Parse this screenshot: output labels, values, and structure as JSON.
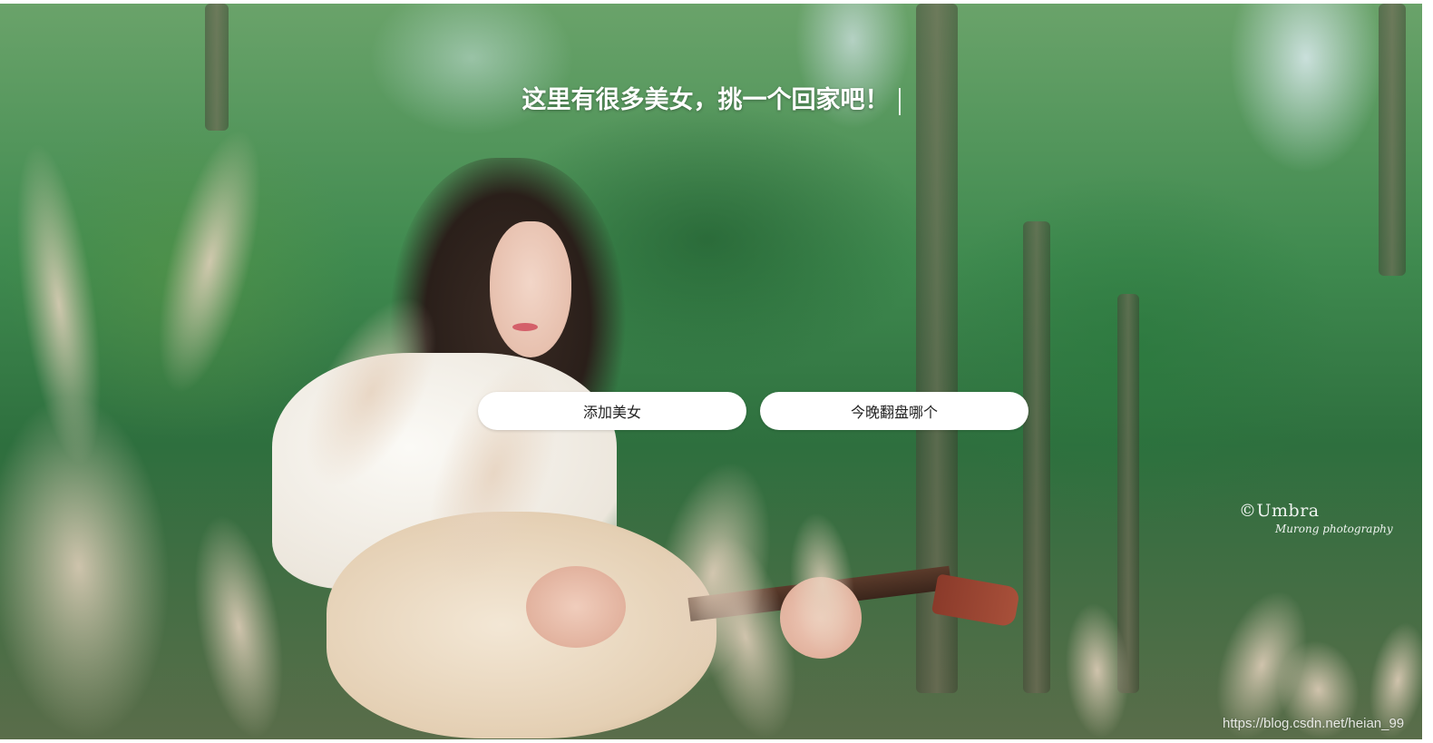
{
  "headline": "这里有很多美女，挑一个回家吧！",
  "buttons": {
    "add": "添加美女",
    "pick": "今晚翻盘哪个"
  },
  "photo_credit": {
    "name": "©Umbra",
    "subtitle": "Murong photography"
  },
  "site_watermark": "https://blog.csdn.net/heian_99",
  "colors": {
    "button_bg": "#ffffff",
    "button_text": "#222222",
    "headline_text": "#ffffff"
  }
}
